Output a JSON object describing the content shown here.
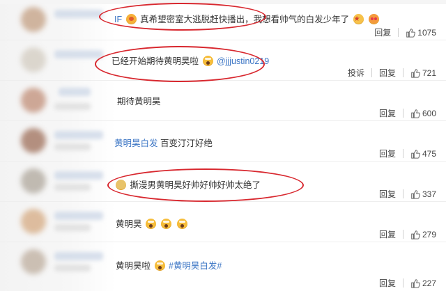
{
  "comments": [
    {
      "prefix": "IF",
      "text": "真希望密室大逃脱赶快播出，我想看帅气的白发少年了",
      "tag": "",
      "reply": "回复",
      "report": "",
      "likes": "1075"
    },
    {
      "prefix": "",
      "text": "已经开始期待黄明昊啦",
      "tag": "@jjjustin0219",
      "reply": "回复",
      "report": "投诉",
      "likes": "721"
    },
    {
      "prefix": "",
      "text": "期待黄明昊",
      "tag": "",
      "reply": "回复",
      "report": "",
      "likes": "600"
    },
    {
      "prefix": "",
      "text": "百变汀汀好绝",
      "tag": "黄明昊白发",
      "reply": "回复",
      "report": "",
      "likes": "475"
    },
    {
      "prefix": "",
      "text": "撕漫男黄明昊好帅好帅好帅太绝了",
      "tag": "",
      "reply": "回复",
      "report": "",
      "likes": "337"
    },
    {
      "prefix": "",
      "text": "黄明昊",
      "tag": "",
      "reply": "回复",
      "report": "",
      "likes": "279"
    },
    {
      "prefix": "",
      "text": "黄明昊啦",
      "tag": "#黄明昊白发#",
      "reply": "回复",
      "report": "",
      "likes": "227"
    }
  ],
  "icons": {
    "like": "thumbs-up-icon"
  },
  "colors": {
    "link": "#3a74c4",
    "annotation": "#d8282f"
  }
}
